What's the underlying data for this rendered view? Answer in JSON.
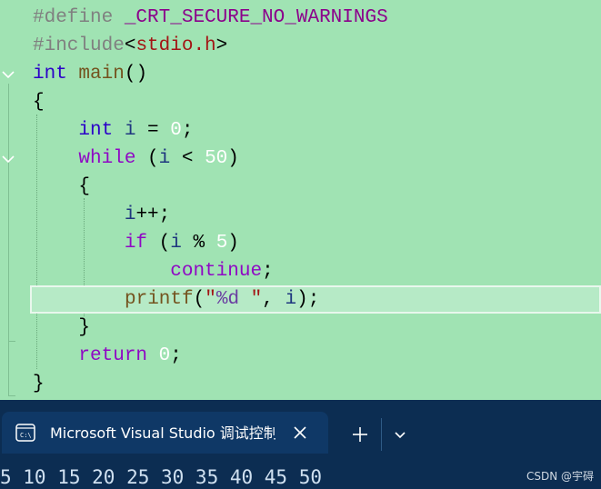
{
  "editor": {
    "lines": [
      [
        {
          "t": "#define ",
          "c": "pp"
        },
        {
          "t": "_CRT_SECURE_NO_WARNINGS",
          "c": "macro"
        }
      ],
      [
        {
          "t": "#include",
          "c": "pp"
        },
        {
          "t": "<",
          "c": "lt"
        },
        {
          "t": "stdio.h",
          "c": "inc"
        },
        {
          "t": ">",
          "c": "lt"
        }
      ],
      [
        {
          "t": "int",
          "c": "kw"
        },
        {
          "t": " ",
          "c": "punc"
        },
        {
          "t": "main",
          "c": "fn"
        },
        {
          "t": "()",
          "c": "punc"
        }
      ],
      [
        {
          "t": "{",
          "c": "punc"
        }
      ],
      [
        {
          "t": "    ",
          "c": "punc"
        },
        {
          "t": "int",
          "c": "kw"
        },
        {
          "t": " ",
          "c": "punc"
        },
        {
          "t": "i",
          "c": "id"
        },
        {
          "t": " = ",
          "c": "punc"
        },
        {
          "t": "0",
          "c": "num"
        },
        {
          "t": ";",
          "c": "punc"
        }
      ],
      [
        {
          "t": "    ",
          "c": "punc"
        },
        {
          "t": "while",
          "c": "ctl"
        },
        {
          "t": " (",
          "c": "punc"
        },
        {
          "t": "i",
          "c": "id"
        },
        {
          "t": " < ",
          "c": "punc"
        },
        {
          "t": "50",
          "c": "num"
        },
        {
          "t": ")",
          "c": "punc"
        }
      ],
      [
        {
          "t": "    {",
          "c": "punc"
        }
      ],
      [
        {
          "t": "        ",
          "c": "punc"
        },
        {
          "t": "i",
          "c": "id"
        },
        {
          "t": "++;",
          "c": "punc"
        }
      ],
      [
        {
          "t": "        ",
          "c": "punc"
        },
        {
          "t": "if",
          "c": "ctl"
        },
        {
          "t": " (",
          "c": "punc"
        },
        {
          "t": "i",
          "c": "id"
        },
        {
          "t": " % ",
          "c": "punc"
        },
        {
          "t": "5",
          "c": "num"
        },
        {
          "t": ")",
          "c": "punc"
        }
      ],
      [
        {
          "t": "            ",
          "c": "punc"
        },
        {
          "t": "continue",
          "c": "ctl"
        },
        {
          "t": ";",
          "c": "punc"
        }
      ],
      [
        {
          "t": "printf",
          "c": "fn"
        },
        {
          "t": "(",
          "c": "punc"
        },
        {
          "t": "\"",
          "c": "str"
        },
        {
          "t": "%d",
          "c": "fmt"
        },
        {
          "t": " \"",
          "c": "str"
        },
        {
          "t": ", ",
          "c": "punc"
        },
        {
          "t": "i",
          "c": "id"
        },
        {
          "t": ");",
          "c": "punc"
        }
      ],
      [
        {
          "t": "    }",
          "c": "punc"
        }
      ],
      [
        {
          "t": "    ",
          "c": "punc"
        },
        {
          "t": "return",
          "c": "ctl"
        },
        {
          "t": " ",
          "c": "punc"
        },
        {
          "t": "0",
          "c": "num"
        },
        {
          "t": ";",
          "c": "punc"
        }
      ],
      [
        {
          "t": "}",
          "c": "punc"
        }
      ]
    ]
  },
  "terminal": {
    "tab_icon": "console-window-icon",
    "tab_title": "Microsoft Visual Studio 调试控制台",
    "close_icon": "close-icon",
    "new_tab_icon": "plus-icon",
    "dropdown_icon": "chevron-down-icon",
    "output": "5 10 15 20 25 30 35 40 45 50"
  },
  "watermark": "CSDN @宇碍",
  "colors": {
    "editor_background": "#a0e3b3",
    "terminal_background": "#0c2d52",
    "tab_background": "#0f3866"
  }
}
